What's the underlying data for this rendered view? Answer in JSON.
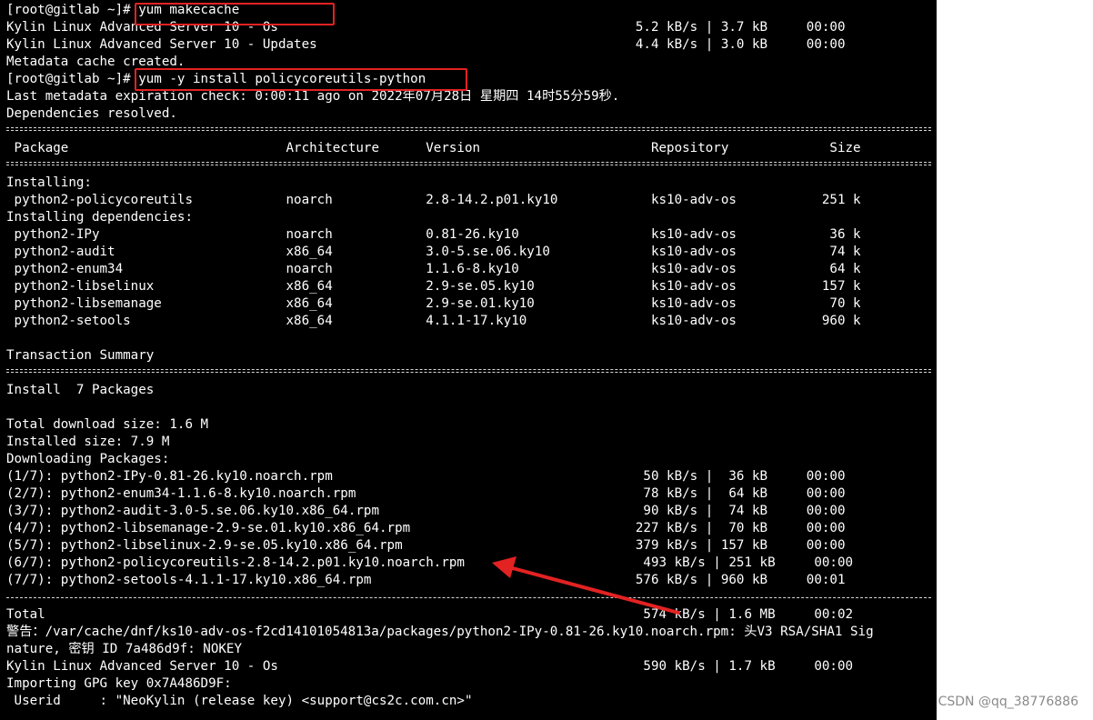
{
  "terminal": {
    "lines": [
      "[root@gitlab ~]# yum makecache",
      "Kylin Linux Advanced Server 10 - Os                                              5.2 kB/s | 3.7 kB     00:00",
      "Kylin Linux Advanced Server 10 - Updates                                         4.4 kB/s | 3.0 kB     00:00",
      "Metadata cache created.",
      "[root@gitlab ~]# yum -y install policycoreutils-python",
      "Last metadata expiration check: 0:00:11 ago on 2022年07月28日 星期四 14时55分59秒.",
      "Dependencies resolved.",
      "",
      " Package                            Architecture      Version                      Repository             Size",
      "",
      "Installing:",
      " python2-policycoreutils            noarch            2.8-14.2.p01.ky10            ks10-adv-os           251 k",
      "Installing dependencies:",
      " python2-IPy                        noarch            0.81-26.ky10                 ks10-adv-os            36 k",
      " python2-audit                      x86_64            3.0-5.se.06.ky10             ks10-adv-os            74 k",
      " python2-enum34                     noarch            1.1.6-8.ky10                 ks10-adv-os            64 k",
      " python2-libselinux                 x86_64            2.9-se.05.ky10               ks10-adv-os           157 k",
      " python2-libsemanage                x86_64            2.9-se.01.ky10               ks10-adv-os            70 k",
      " python2-setools                    x86_64            4.1.1-17.ky10                ks10-adv-os           960 k",
      "",
      "Transaction Summary",
      "",
      "Install  7 Packages",
      "",
      "Total download size: 1.6 M",
      "Installed size: 7.9 M",
      "Downloading Packages:",
      "(1/7): python2-IPy-0.81-26.ky10.noarch.rpm                                        50 kB/s |  36 kB     00:00",
      "(2/7): python2-enum34-1.1.6-8.ky10.noarch.rpm                                     78 kB/s |  64 kB     00:00",
      "(3/7): python2-audit-3.0-5.se.06.ky10.x86_64.rpm                                  90 kB/s |  74 kB     00:00",
      "(4/7): python2-libsemanage-2.9-se.01.ky10.x86_64.rpm                             227 kB/s |  70 kB     00:00",
      "(5/7): python2-libselinux-2.9-se.05.ky10.x86_64.rpm                              379 kB/s | 157 kB     00:00",
      "(6/7): python2-policycoreutils-2.8-14.2.p01.ky10.noarch.rpm                       493 kB/s | 251 kB     00:00",
      "(7/7): python2-setools-4.1.1-17.ky10.x86_64.rpm                                  576 kB/s | 960 kB     00:01",
      "",
      "Total                                                                             574 kB/s | 1.6 MB     00:02",
      "警告：/var/cache/dnf/ks10-adv-os-f2cd14101054813a/packages/python2-IPy-0.81-26.ky10.noarch.rpm: 头V3 RSA/SHA1 Sig",
      "nature, 密钥 ID 7a486d9f: NOKEY",
      "Kylin Linux Advanced Server 10 - Os                                               590 kB/s | 1.7 kB     00:00",
      "Importing GPG key 0x7A486D9F:",
      " Userid     : \"NeoKylin (release key) <support@cs2c.com.cn>\""
    ]
  },
  "annotations": {
    "box_color": "#e32222",
    "arrow_color": "#e32222"
  },
  "watermark": "CSDN @qq_38776886",
  "colors": {
    "terminal_bg": "#000000",
    "terminal_fg": "#ffffff",
    "page_bg": "#ffffff"
  }
}
